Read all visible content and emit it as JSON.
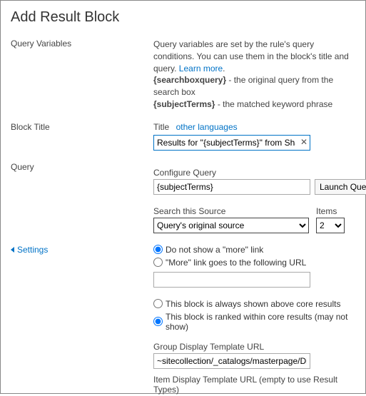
{
  "page_title": "Add Result Block",
  "sections": {
    "query_variables": {
      "heading": "Query Variables",
      "description_part1": "Query variables are set by the rule's query conditions. You can use them in the block's title and query. ",
      "learn_more": "Learn more",
      "desc_line2_prefix": "{searchboxquery}",
      "desc_line2_rest": " - the original query from the search box",
      "desc_line3_prefix": "{subjectTerms}",
      "desc_line3_rest": " - the matched keyword phrase"
    },
    "block_title": {
      "heading": "Block Title",
      "title_label": "Title",
      "other_languages": "other languages",
      "title_value": "Results for \"{subjectTerms}\" from SharePoint"
    },
    "query": {
      "heading": "Query",
      "configure_label": "Configure Query",
      "configure_value": "{subjectTerms}",
      "launch_button": "Launch Query Builder",
      "source_label": "Search this Source",
      "source_value": "Query's original source",
      "items_label": "Items",
      "items_value": "2"
    },
    "settings": {
      "heading": "Settings",
      "more_no": "Do not show a \"more\" link",
      "more_url": "\"More\" link goes to the following URL",
      "url_value": "",
      "pos_above": "This block is always shown above core results",
      "pos_ranked": "This block is ranked within core results (may not show)",
      "group_template_label": "Group Display Template URL",
      "group_template_value": "~sitecollection/_catalogs/masterpage/Display Templates/Search/Group_Default.js",
      "item_template_label": "Item Display Template URL (empty to use Result Types)"
    }
  }
}
